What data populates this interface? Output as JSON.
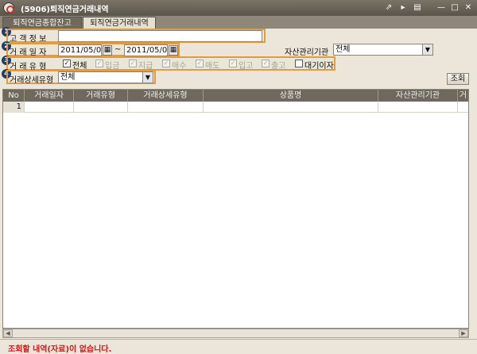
{
  "window": {
    "title": "(5906)퇴직연금거래내역",
    "controls": [
      "⇗",
      "▸",
      "▤",
      "—",
      "□",
      "✕"
    ]
  },
  "tabs": [
    {
      "label": "퇴직연금종합잔고",
      "active": false
    },
    {
      "label": "퇴직연금거래내역",
      "active": true
    }
  ],
  "form": {
    "customer_info": {
      "label": "고 객 정 보",
      "value": ""
    },
    "trade_date": {
      "label": "거 래 일 자",
      "from": "2011/05/06",
      "to": "2011/05/06",
      "separator": "~"
    },
    "asset_institution": {
      "label": "자산관리기관",
      "value": "전체"
    },
    "trade_type": {
      "label": "거 래 유 형",
      "options": [
        {
          "label": "전체",
          "checked": true,
          "enabled": true
        },
        {
          "label": "입금",
          "checked": true,
          "enabled": false
        },
        {
          "label": "지급",
          "checked": true,
          "enabled": false
        },
        {
          "label": "매수",
          "checked": true,
          "enabled": false
        },
        {
          "label": "매도",
          "checked": true,
          "enabled": false
        },
        {
          "label": "입고",
          "checked": true,
          "enabled": false
        },
        {
          "label": "출고",
          "checked": true,
          "enabled": false
        },
        {
          "label": "대기이자",
          "checked": false,
          "enabled": true
        }
      ]
    },
    "trade_detail_type": {
      "label": "거래상세유형",
      "value": "전체"
    },
    "search_button": "조회"
  },
  "badges": [
    "1",
    "2",
    "3",
    "4"
  ],
  "table": {
    "columns": [
      "No",
      "거래일자",
      "거래유형",
      "거래상세유형",
      "상품명",
      "자산관리기관",
      "거"
    ],
    "rows": [
      {
        "no": "1"
      }
    ]
  },
  "status": {
    "message": "조회할 내역(자료)이 없습니다.",
    "color": "#d41414"
  }
}
